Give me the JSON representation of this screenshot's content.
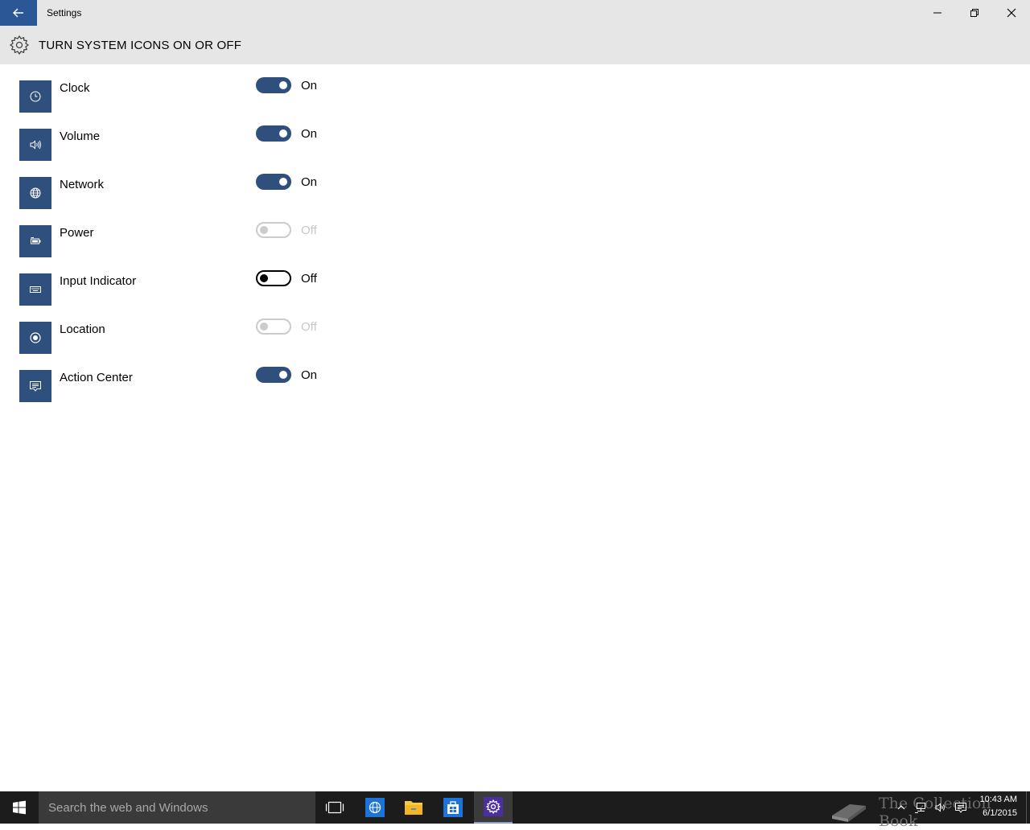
{
  "window": {
    "title": "Settings",
    "minimize_label": "Minimize",
    "maximize_label": "Restore",
    "close_label": "Close"
  },
  "header": {
    "title": "TURN SYSTEM ICONS ON OR OFF"
  },
  "settings": [
    {
      "label": "Clock",
      "state": "On",
      "icon": "clock-icon",
      "enabled": true
    },
    {
      "label": "Volume",
      "state": "On",
      "icon": "volume-icon",
      "enabled": true
    },
    {
      "label": "Network",
      "state": "On",
      "icon": "network-icon",
      "enabled": true
    },
    {
      "label": "Power",
      "state": "Off",
      "icon": "battery-icon",
      "enabled": false
    },
    {
      "label": "Input Indicator",
      "state": "Off",
      "icon": "keyboard-icon",
      "enabled": true
    },
    {
      "label": "Location",
      "state": "Off",
      "icon": "location-icon",
      "enabled": false
    },
    {
      "label": "Action Center",
      "state": "On",
      "icon": "action-center-icon",
      "enabled": true
    }
  ],
  "taskbar": {
    "search_placeholder": "Search the web and Windows",
    "pinned": [
      "task-view-icon",
      "edge-icon",
      "file-explorer-icon",
      "store-icon",
      "settings-icon"
    ],
    "watermark": "The Collection Book",
    "time": "10:43 AM",
    "date": "6/1/2015"
  },
  "colors": {
    "accent": "#2f4f7c",
    "back_button": "#2b5797",
    "titlebar": "#e6e6e6",
    "taskbar": "#1c1c1c"
  }
}
